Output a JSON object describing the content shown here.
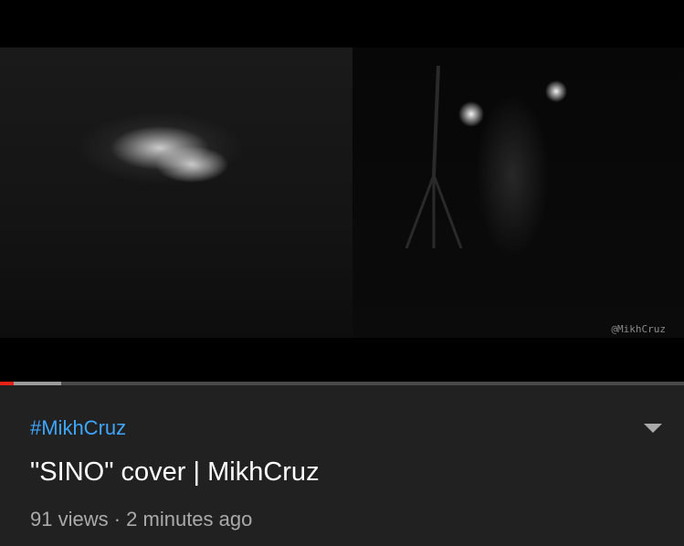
{
  "player": {
    "watermark": "@MikhCruz",
    "progress_fraction": 0.005,
    "buffered_fraction": 0.09
  },
  "video": {
    "hashtag": "#MikhCruz",
    "title": "\"SINO\" cover | MikhCruz",
    "views": "91 views",
    "separator": " · ",
    "age": "2 minutes ago"
  },
  "icons": {
    "expand": "chevron-down-icon"
  },
  "colors": {
    "accent_red": "#e62117",
    "link_blue": "#3ea6ff",
    "background": "#212121"
  }
}
